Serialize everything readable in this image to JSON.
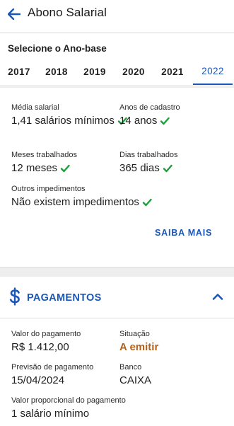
{
  "header": {
    "title": "Abono Salarial",
    "back_icon": "arrow-left-icon"
  },
  "year_selector": {
    "label": "Selecione o Ano-base",
    "years": [
      "2017",
      "2018",
      "2019",
      "2020",
      "2021",
      "2022"
    ],
    "selected": "2022"
  },
  "details": {
    "media_salarial": {
      "label": "Média salarial",
      "value": "1,41 salários mínimos"
    },
    "anos_cadastro": {
      "label": "Anos de cadastro",
      "value": "14 anos"
    },
    "meses_trabalhados": {
      "label": "Meses trabalhados",
      "value": "12 meses"
    },
    "dias_trabalhados": {
      "label": "Dias trabalhados",
      "value": "365 dias"
    },
    "outros_impedimentos": {
      "label": "Outros impedimentos",
      "value": "Não existem impedimentos"
    },
    "saiba_mais": "SAIBA MAIS"
  },
  "pagamentos": {
    "title": "PAGAMENTOS",
    "valor": {
      "label": "Valor do pagamento",
      "value": "R$ 1.412,00"
    },
    "situacao": {
      "label": "Situação",
      "value": "A emitir"
    },
    "previsao": {
      "label": "Previsão de pagamento",
      "value": "15/04/2024"
    },
    "banco": {
      "label": "Banco",
      "value": "CAIXA"
    },
    "proporcional": {
      "label": "Valor proporcional do pagamento",
      "value": "1 salário mínimo"
    }
  },
  "colors": {
    "accent_blue": "#1a57b8",
    "check_green": "#1e9e3a",
    "status_orange": "#b3611a"
  }
}
